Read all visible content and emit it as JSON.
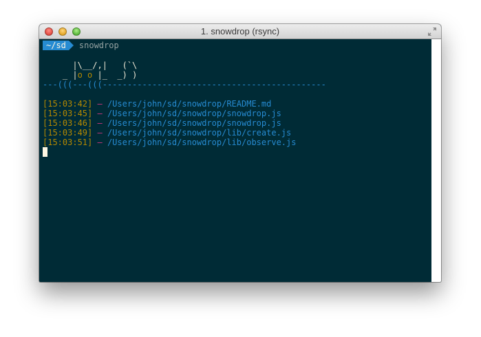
{
  "window": {
    "title": "1. snowdrop (rsync)"
  },
  "prompt": {
    "directory": "~/sd",
    "command": "snowdrop"
  },
  "ascii_art": {
    "line1": "      |\\__/,|   (`\\",
    "line2_a": "    _ |",
    "line2_eyes": "o o",
    "line2_b": " |_  _) )",
    "ground": "---(((---(((---------------------------------------------"
  },
  "log": [
    {
      "time": "[15:03:42]",
      "sep": " – ",
      "path": "/Users/john/sd/snowdrop/README.md"
    },
    {
      "time": "[15:03:45]",
      "sep": " – ",
      "path": "/Users/john/sd/snowdrop/snowdrop.js"
    },
    {
      "time": "[15:03:46]",
      "sep": " – ",
      "path": "/Users/john/sd/snowdrop/snowdrop.js"
    },
    {
      "time": "[15:03:49]",
      "sep": " – ",
      "path": "/Users/john/sd/snowdrop/lib/create.js"
    },
    {
      "time": "[15:03:51]",
      "sep": " – ",
      "path": "/Users/john/sd/snowdrop/lib/observe.js"
    }
  ],
  "icons": {
    "close": "close-button-icon",
    "minimize": "minimize-button-icon",
    "zoom": "zoom-button-icon",
    "fullscreen": "fullscreen-arrows-icon"
  },
  "colors": {
    "background": "#002b36",
    "timestamp": "#b58900",
    "separator": "#d33682",
    "path": "#268bd2",
    "prompt_badge": "#268bd2"
  }
}
